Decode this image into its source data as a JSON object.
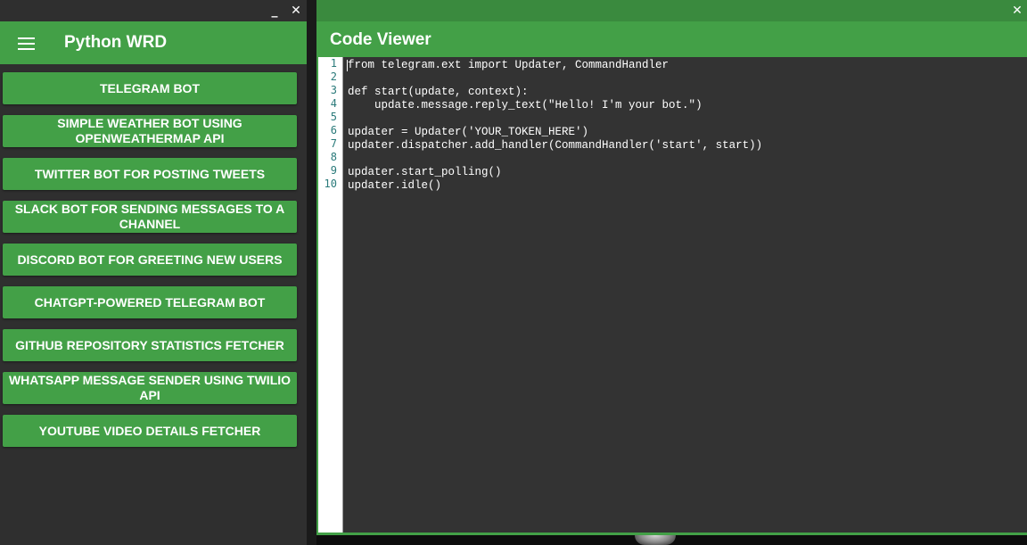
{
  "left_window": {
    "minimize_glyph": "_",
    "close_glyph": "✕",
    "app_title": "Python WRD",
    "menu_icon": "hamburger-icon",
    "items": [
      {
        "label": "TELEGRAM BOT"
      },
      {
        "label": "SIMPLE WEATHER BOT USING OPENWEATHERMAP API"
      },
      {
        "label": "TWITTER BOT FOR POSTING TWEETS"
      },
      {
        "label": "SLACK BOT FOR SENDING MESSAGES TO A CHANNEL"
      },
      {
        "label": "DISCORD BOT FOR GREETING NEW USERS"
      },
      {
        "label": "CHATGPT-POWERED TELEGRAM BOT"
      },
      {
        "label": "GITHUB REPOSITORY STATISTICS FETCHER"
      },
      {
        "label": "WHATSAPP MESSAGE SENDER USING TWILIO API"
      },
      {
        "label": "YOUTUBE VIDEO DETAILS FETCHER"
      }
    ]
  },
  "right_window": {
    "close_glyph": "✕",
    "title": "Code Viewer",
    "line_numbers": [
      "1",
      "2",
      "3",
      "4",
      "5",
      "6",
      "7",
      "8",
      "9",
      "10"
    ],
    "code": [
      "from telegram.ext import Updater, CommandHandler",
      "",
      "def start(update, context):",
      "    update.message.reply_text(\"Hello! I'm your bot.\")",
      "",
      "updater = Updater('YOUR_TOKEN_HERE')",
      "updater.dispatcher.add_handler(CommandHandler('start', start))",
      "",
      "updater.start_polling()",
      "updater.idle()"
    ]
  },
  "colors": {
    "accent_green": "#43a047",
    "dark_panel": "#2f2f2f",
    "code_bg": "#333333",
    "line_number": "#2a7a7a"
  }
}
